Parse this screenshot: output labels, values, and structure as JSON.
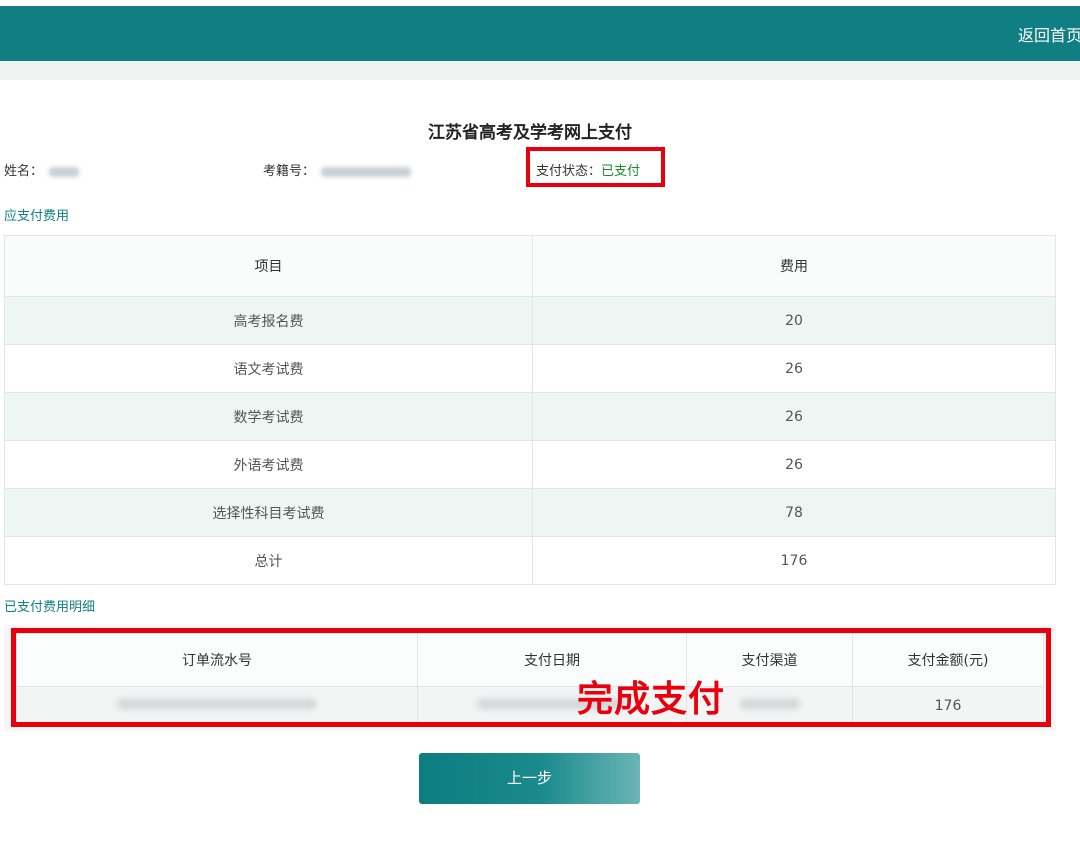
{
  "header": {
    "home_link": "返回首页"
  },
  "page": {
    "title": "江苏省高考及学考网上支付"
  },
  "info": {
    "name_label": "姓名：",
    "exam_no_label": "考籍号：",
    "status_label": "支付状态：",
    "status_value": "已支付"
  },
  "fees": {
    "section_title": "应支付费用",
    "headers": [
      "项目",
      "费用"
    ],
    "rows": [
      [
        "高考报名费",
        "20"
      ],
      [
        "语文考试费",
        "26"
      ],
      [
        "数学考试费",
        "26"
      ],
      [
        "外语考试费",
        "26"
      ],
      [
        "选择性科目考试费",
        "78"
      ],
      [
        "总计",
        "176"
      ]
    ]
  },
  "payments": {
    "section_title": "已支付费用明细",
    "headers": [
      "订单流水号",
      "支付日期",
      "支付渠道",
      "支付金额(元)"
    ],
    "amount": "176",
    "overlay_text": "完成支付"
  },
  "actions": {
    "prev_label": "上一步"
  },
  "colors": {
    "brand": "#0f7f83",
    "highlight": "#e8000d",
    "paid": "#1c8a2f"
  }
}
